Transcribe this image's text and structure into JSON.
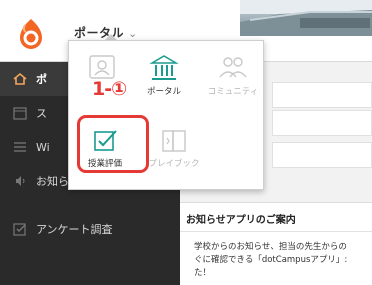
{
  "header": {
    "portal_label": "ポータル",
    "chevron": "⌄"
  },
  "sidebar": {
    "items": [
      {
        "label": "ポ",
        "icon": "home-icon",
        "active": true
      },
      {
        "label": "ス",
        "icon": "calendar-icon",
        "active": false
      },
      {
        "label": "Wi",
        "icon": "list-icon",
        "active": false
      },
      {
        "label": "お知らせ",
        "icon": "speaker-icon",
        "active": false
      },
      {
        "label": "アンケート調査",
        "icon": "survey-icon",
        "active": false
      }
    ]
  },
  "popup": {
    "tiles": [
      {
        "label": "",
        "icon": "profile-icon",
        "state": "muted"
      },
      {
        "label": "ポータル",
        "icon": "institution-icon",
        "state": "active"
      },
      {
        "label": "コミュニティ",
        "icon": "community-icon",
        "state": "muted"
      },
      {
        "label": "授業評価",
        "icon": "evaluation-icon",
        "state": "active"
      },
      {
        "label": "プレイブック",
        "icon": "playbook-icon",
        "state": "muted"
      }
    ]
  },
  "annotation": {
    "step": "1-①"
  },
  "notice": {
    "title": "お知らせアプリのご案内",
    "body": "学校からのお知らせ、担当の先生からの\nぐに確認できる「dotCampusアプリ」:\nた！"
  },
  "colors": {
    "teal": "#1a9b8f",
    "red": "#e53935",
    "sidebar": "#2a2a2a",
    "logo_orange": "#f26522"
  }
}
